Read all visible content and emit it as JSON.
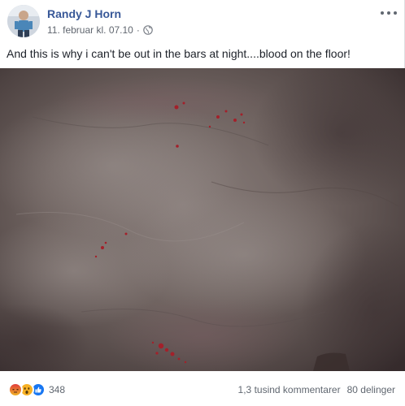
{
  "post": {
    "author": "Randy J Horn",
    "timestamp": "11. februar kl. 07.10",
    "separator": "·",
    "privacy_icon": "globe-icon",
    "more_icon": "more-options-icon",
    "text": "And this is why i can't be out in the bars at night....blood on the floor!"
  },
  "footer": {
    "reaction_icons": [
      "angry-reaction-icon",
      "wow-reaction-icon",
      "like-reaction-icon"
    ],
    "reaction_count": "348",
    "comments": "1,3 tusind kommentarer",
    "shares": "80 delinger"
  },
  "colors": {
    "author_link": "#385898",
    "meta_text": "#616770",
    "floor_base": "#6b5f5d",
    "blood": "#a3202a",
    "like_blue": "#1877f2",
    "angry_red": "#e9710f",
    "wow_yellow": "#f7b125"
  }
}
